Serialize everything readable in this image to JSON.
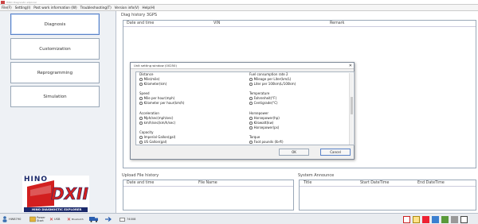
{
  "window": {
    "title": "HINO Diagnostic eXplorer"
  },
  "menu": [
    "File(F)",
    "Setting(I)",
    "Post work information (W)",
    "Troubleshooting(T)",
    "Version info(V)",
    "Help(H)"
  ],
  "nav": [
    "Diagnosis",
    "Customization",
    "Reprogramming",
    "Simulation"
  ],
  "diag_history": {
    "title": "Diag history  3GPS",
    "columns": [
      "Date and time",
      "VIN",
      "Remark"
    ]
  },
  "upload_history": {
    "title": "Upload File history",
    "columns": [
      "Date and time",
      "File Name"
    ]
  },
  "announce": {
    "title": "System Announce",
    "columns": [
      "Title",
      "Start DateTime",
      "End DateTime"
    ]
  },
  "logo": {
    "brand": "HINO",
    "product": "DXII",
    "tagline": "HINO DIAGNOSTIC EXPLORER"
  },
  "status": {
    "user": "HW8790",
    "items": [
      "Power Start",
      "USB",
      "Bluetooth"
    ],
    "voltage": "74008"
  },
  "dialog": {
    "title": "Unit setting window (00250)",
    "left_groups": [
      {
        "title": "Distance",
        "options": [
          "Mile(mile)",
          "Kilometer(km)"
        ]
      },
      {
        "title": "Speed",
        "options": [
          "Mile per hour(mph)",
          "Kilometer per hour(km/h)"
        ]
      },
      {
        "title": "Acceleration",
        "options": [
          "Mph/sec(mph/sec)",
          "km/h/sec(km/h/sec)"
        ]
      },
      {
        "title": "Capacity",
        "options": [
          "Imperial Gallon(gal)",
          "US Gallon(gal)"
        ]
      }
    ],
    "right_groups": [
      {
        "title": "Fuel consumption rate 2",
        "options": [
          "Mileage per Liter(km/L)",
          "Liter per 100km(L/100km)"
        ]
      },
      {
        "title": "Temperature",
        "options": [
          "Fahrenheit(°F)",
          "Centigrade(°C)"
        ]
      },
      {
        "title": "Horsepower",
        "options": [
          "Horsepower(hp)",
          "Kilowatt(kw)",
          "Horsepower(ps)"
        ]
      },
      {
        "title": "Torque",
        "options": [
          "Foot pounds (lb-ft)"
        ]
      }
    ],
    "ok_label": "OK",
    "cancel_label": "Cancel"
  },
  "colors": {
    "accent": "#5a82c8",
    "panel_bg": "#eef1f5",
    "logo_red": "#d21f1f",
    "logo_navy": "#1b2a6b"
  }
}
